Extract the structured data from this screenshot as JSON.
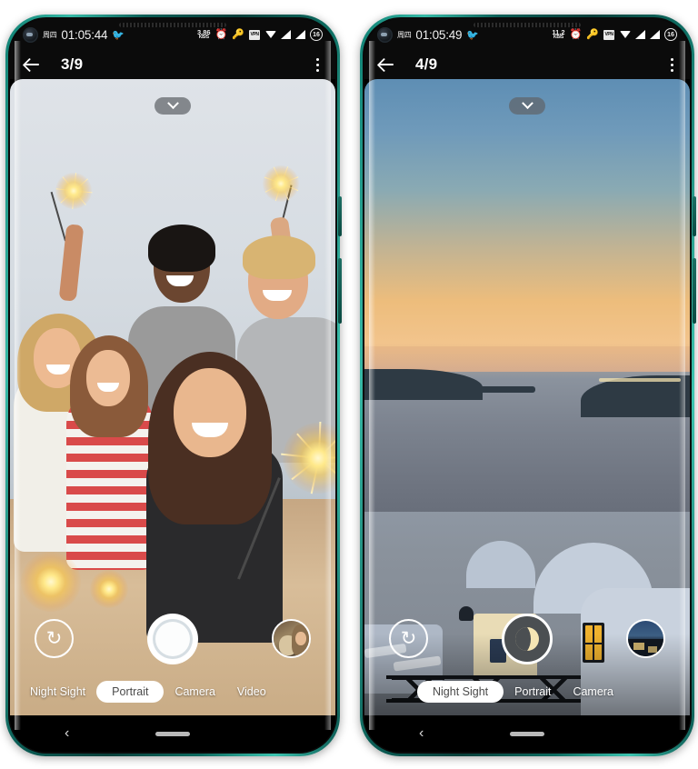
{
  "phones": [
    {
      "id": "left",
      "statusbar": {
        "day": "周四",
        "time": "01:05:44",
        "emoji": "🐦",
        "net_speed": "3.86",
        "net_unit": "KB/S",
        "alarm_icon": "⏰",
        "key_icon": "🔑",
        "vpn_label": "VPN",
        "wifi_icon": "wifi-icon",
        "signal_icon": "signal-icon",
        "battery": "16"
      },
      "appbar": {
        "back_icon": "back-arrow-icon",
        "pager": "3/9",
        "menu_icon": "kebab-menu-icon"
      },
      "viewfinder": {
        "expand_icon": "chevron-down-icon",
        "scene": "group-sparklers-beach"
      },
      "controls": {
        "flip_icon": "camera-flip-icon",
        "shutter_type": "photo",
        "shutter_name": "shutter-button",
        "thumbnail_name": "gallery-thumbnail"
      },
      "modes": [
        {
          "label": "Night Sight",
          "selected": false
        },
        {
          "label": "Portrait",
          "selected": true
        },
        {
          "label": "Camera",
          "selected": false
        },
        {
          "label": "Video",
          "selected": false
        }
      ],
      "navbar": {
        "back": "‹",
        "home": "home-indicator"
      }
    },
    {
      "id": "right",
      "statusbar": {
        "day": "周四",
        "time": "01:05:49",
        "emoji": "🐦",
        "net_speed": "11.2",
        "net_unit": "KB/S",
        "alarm_icon": "⏰",
        "key_icon": "🔑",
        "vpn_label": "VPN",
        "wifi_icon": "wifi-icon",
        "signal_icon": "signal-icon",
        "battery": "16"
      },
      "appbar": {
        "back_icon": "back-arrow-icon",
        "pager": "4/9",
        "menu_icon": "kebab-menu-icon"
      },
      "viewfinder": {
        "expand_icon": "chevron-down-icon",
        "scene": "santorini-sunset"
      },
      "controls": {
        "flip_icon": "camera-flip-icon",
        "shutter_type": "night",
        "shutter_name": "shutter-button",
        "thumbnail_name": "gallery-thumbnail"
      },
      "modes": [
        {
          "label": "Night Sight",
          "selected": true
        },
        {
          "label": "Portrait",
          "selected": false
        },
        {
          "label": "Camera",
          "selected": false
        }
      ],
      "navbar": {
        "back": "‹",
        "home": "home-indicator"
      }
    }
  ],
  "colors": {
    "frame_teal": "#14897b",
    "status_bg": "#0b0b0b",
    "accent_white": "#ffffff",
    "shutter_night_bg": "#4b4f52",
    "moon": "#f6e6b4"
  }
}
